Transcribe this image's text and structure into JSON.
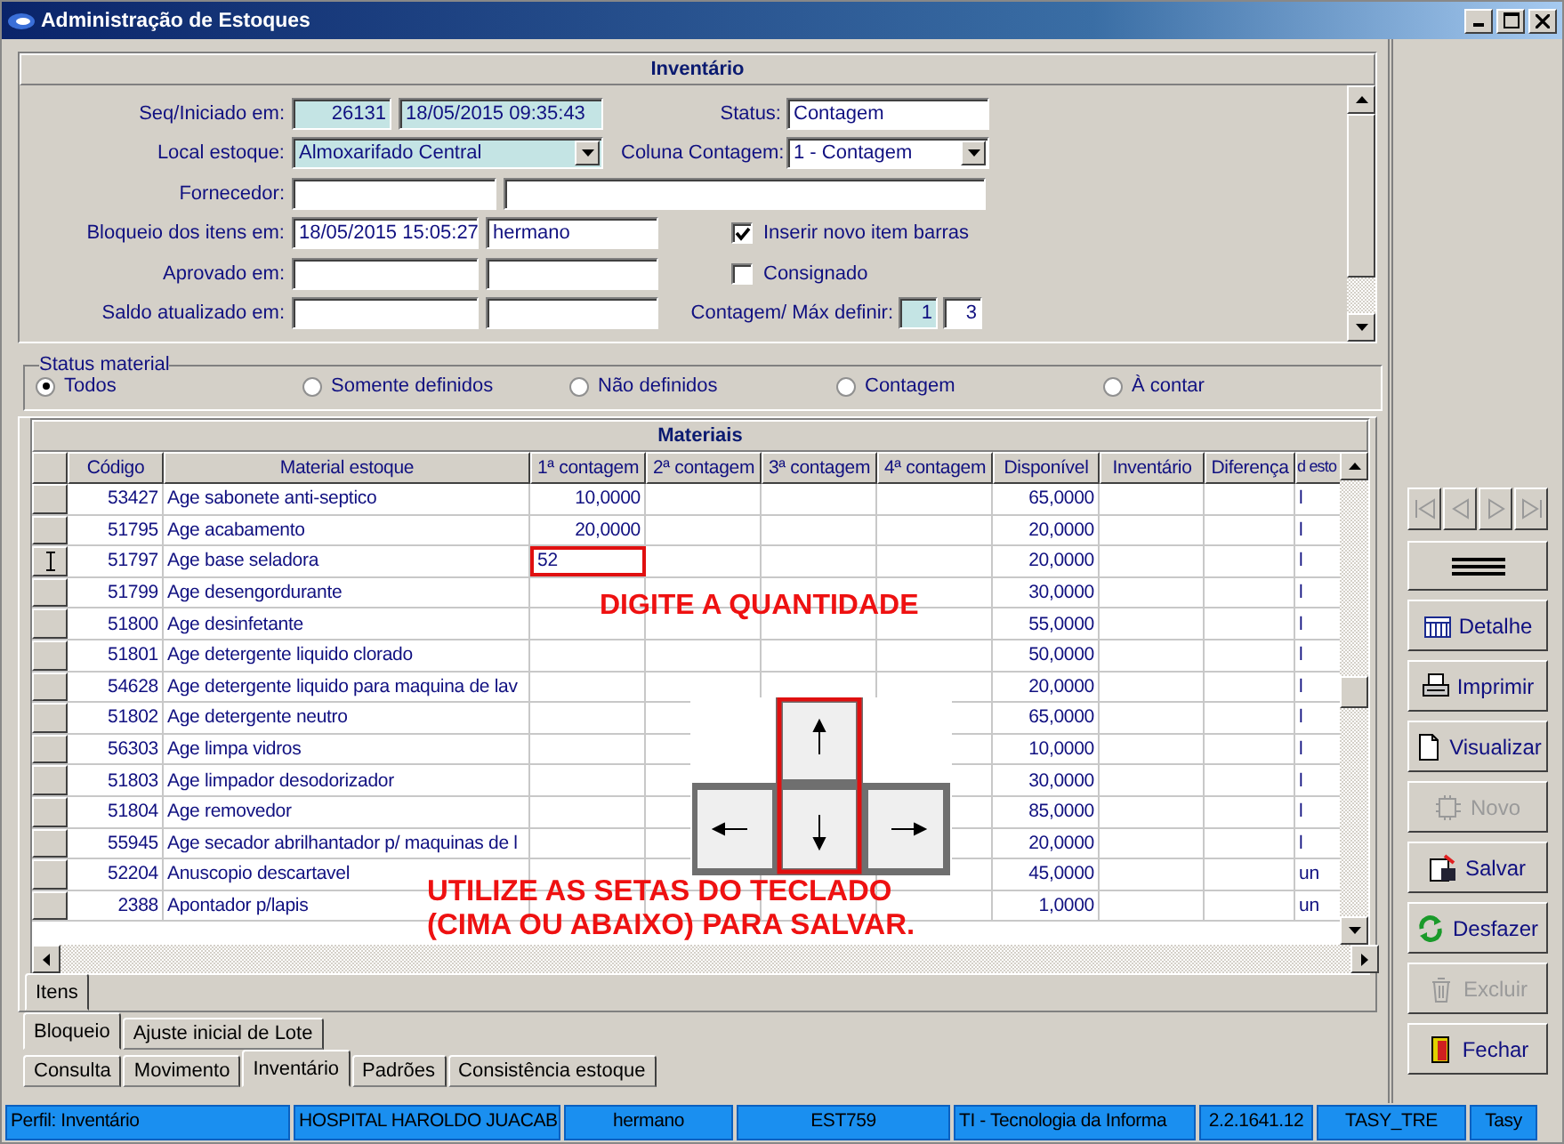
{
  "window": {
    "title": "Administração de Estoques"
  },
  "inventario": {
    "title": "Inventário",
    "rows": [
      {
        "label": "Seq/Iniciado em:",
        "fields": [
          {
            "kind": "text",
            "value": "26131",
            "readonly": true
          },
          {
            "kind": "text",
            "value": "18/05/2015 09:35:43",
            "readonly": true
          }
        ],
        "right": {
          "kind": "fields",
          "label": "Status:",
          "fields": [
            {
              "kind": "text",
              "value": "Contagem",
              "readonly": false
            }
          ]
        }
      },
      {
        "label": "Local estoque:",
        "fields": [
          {
            "kind": "dropdown",
            "value": "Almoxarifado Central",
            "readonly": true
          }
        ],
        "right": {
          "kind": "fields",
          "label": "Coluna Contagem:",
          "fields": [
            {
              "kind": "dropdown",
              "value": "1 - Contagem",
              "readonly": false
            }
          ]
        }
      },
      {
        "label": "Fornecedor:",
        "fields": [
          {
            "kind": "text",
            "readonly": false
          },
          {
            "kind": "text",
            "readonly": false
          }
        ]
      },
      {
        "label": "Bloqueio dos itens em:",
        "fields": [
          {
            "kind": "text",
            "value": "18/05/2015 15:05:27",
            "readonly": false
          },
          {
            "kind": "text",
            "value": "hermano",
            "readonly": false
          }
        ],
        "right": {
          "kind": "checkbox",
          "label": "Inserir novo item barras",
          "checked": true
        }
      },
      {
        "label": "Aprovado em:",
        "fields": [
          {
            "kind": "text",
            "readonly": false
          },
          {
            "kind": "text",
            "readonly": false
          }
        ],
        "right": {
          "kind": "checkbox",
          "label": "Consignado",
          "checked": false
        }
      },
      {
        "label": "Saldo atualizado em:",
        "fields": [
          {
            "kind": "text",
            "readonly": false
          },
          {
            "kind": "text",
            "readonly": false
          }
        ],
        "right": {
          "kind": "fields",
          "label": "Contagem/ Máx definir:",
          "fields": [
            {
              "kind": "text",
              "value": "1",
              "readonly": true
            },
            {
              "kind": "text",
              "value": "3",
              "readonly": false
            }
          ]
        }
      }
    ]
  },
  "status_material": {
    "legend": "Status material",
    "options": [
      {
        "label": "Todos",
        "selected": true
      },
      {
        "label": "Somente definidos",
        "selected": false
      },
      {
        "label": "Não definidos",
        "selected": false
      },
      {
        "label": "Contagem",
        "selected": false
      },
      {
        "label": "À contar",
        "selected": false
      }
    ]
  },
  "materiais": {
    "title": "Materiais",
    "columns": [
      "Código",
      "Material estoque",
      "1ª contagem",
      "2ª contagem",
      "3ª contagem",
      "4ª contagem",
      "Disponível",
      "Inventário",
      "Diferença",
      "d esto"
    ],
    "rows": [
      {
        "code": "53427",
        "material": "Age sabonete anti-septico",
        "count_1": "10,0000",
        "available": "65,0000",
        "column_10": "l",
        "editing": false
      },
      {
        "code": "51795",
        "material": "Age acabamento",
        "count_1": "20,0000",
        "available": "20,0000",
        "column_10": "l",
        "editing": false
      },
      {
        "code": "51797",
        "material": "Age base seladora",
        "count_1": "52",
        "available": "20,0000",
        "column_10": "l",
        "editing": true
      },
      {
        "code": "51799",
        "material": "Age desengordurante",
        "available": "30,0000",
        "column_10": "l",
        "editing": false
      },
      {
        "code": "51800",
        "material": "Age desinfetante",
        "available": "55,0000",
        "column_10": "l",
        "editing": false
      },
      {
        "code": "51801",
        "material": "Age detergente liquido clorado",
        "available": "50,0000",
        "column_10": "l",
        "editing": false
      },
      {
        "code": "54628",
        "material": "Age detergente liquido para maquina de lav",
        "available": "20,0000",
        "column_10": "l",
        "editing": false
      },
      {
        "code": "51802",
        "material": "Age detergente neutro",
        "available": "65,0000",
        "column_10": "l",
        "editing": false
      },
      {
        "code": "56303",
        "material": "Age limpa vidros",
        "available": "10,0000",
        "column_10": "l",
        "editing": false
      },
      {
        "code": "51803",
        "material": "Age limpador desodorizador",
        "available": "30,0000",
        "column_10": "l",
        "editing": false
      },
      {
        "code": "51804",
        "material": "Age removedor",
        "available": "85,0000",
        "column_10": "l",
        "editing": false
      },
      {
        "code": "55945",
        "material": "Age secador abrilhantador p/ maquinas de l",
        "available": "20,0000",
        "column_10": "l",
        "editing": false
      },
      {
        "code": "52204",
        "material": "Anuscopio descartavel",
        "available": "45,0000",
        "column_10": "un",
        "editing": false
      },
      {
        "code": "2388",
        "material": "Apontador p/lapis",
        "available": "1,0000",
        "column_10": "un",
        "editing": false
      }
    ]
  },
  "annotation": {
    "top": "DIGITE A QUANTIDADE",
    "bottom_lines": [
      "UTILIZE AS SETAS DO TECLADO",
      "(CIMA OU ABAIXO) PARA SALVAR."
    ]
  },
  "inner_tabs": [
    {
      "label": "Itens",
      "selected": true
    }
  ],
  "section_tabs": [
    {
      "label": "Bloqueio",
      "selected": true
    },
    {
      "label": "Ajuste inicial de Lote",
      "selected": false
    }
  ],
  "bottom_tabs": [
    {
      "label": "Consulta",
      "selected": false
    },
    {
      "label": "Movimento",
      "selected": false
    },
    {
      "label": "Inventário",
      "selected": true
    },
    {
      "label": "Padrões",
      "selected": false
    },
    {
      "label": "Consistência estoque",
      "selected": false
    }
  ],
  "side_buttons": [
    {
      "kind": "detail",
      "label": "Detalhe",
      "disabled": false
    },
    {
      "kind": "print",
      "label": "Imprimir",
      "disabled": false
    },
    {
      "kind": "view",
      "label": "Visualizar",
      "disabled": false
    },
    {
      "kind": "new",
      "label": "Novo",
      "disabled": true
    },
    {
      "kind": "save",
      "label": "Salvar",
      "disabled": false
    },
    {
      "kind": "undo",
      "label": "Desfazer",
      "disabled": false
    },
    {
      "kind": "delete",
      "label": "Excluir",
      "disabled": true
    },
    {
      "kind": "close",
      "label": "Fechar",
      "disabled": false
    }
  ],
  "status_bar": [
    "Perfil: Inventário",
    "HOSPITAL HAROLDO JUACAB",
    "hermano",
    "EST759",
    "TI - Tecnologia da Informa",
    "2.2.1641.12",
    "TASY_TRE",
    "Tasy"
  ]
}
